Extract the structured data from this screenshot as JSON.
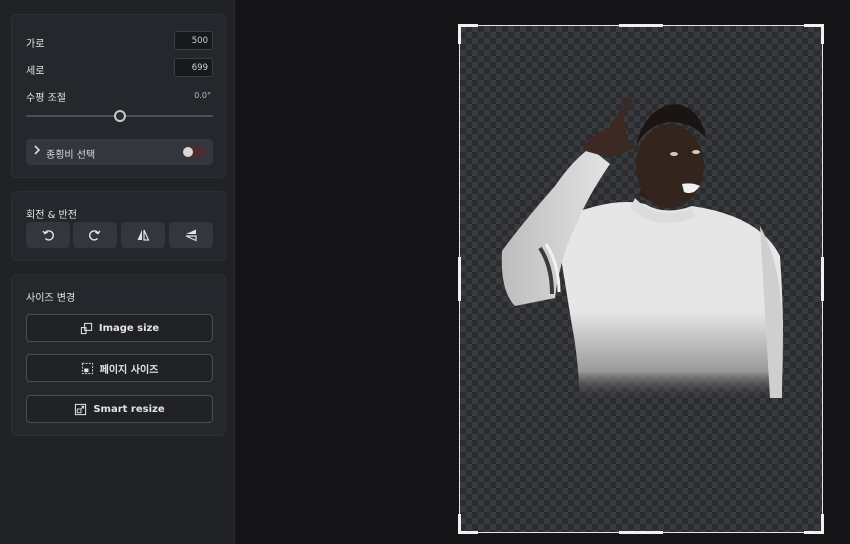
{
  "sidebar": {
    "dimensions": {
      "width_label": "가로",
      "width_value": "500",
      "height_label": "세로",
      "height_value": "699",
      "straighten_label": "수평 조절",
      "straighten_value": "0.0°",
      "aspect_label": "종횡비 선택",
      "aspect_lock_on": false
    },
    "rotate_flip": {
      "title": "회전 & 반전",
      "buttons": [
        "rotate-left-icon",
        "rotate-right-icon",
        "flip-horizontal-icon",
        "flip-vertical-icon"
      ]
    },
    "resize": {
      "title": "사이즈 변경",
      "image_size_label": "Image size",
      "page_size_label": "페이지 사이즈",
      "smart_resize_label": "Smart resize"
    }
  },
  "colors": {
    "sidebar_bg": "#202226",
    "panel_bg": "#24272c",
    "canvas_bg": "#151517",
    "toggle_off": "#4a2e31"
  }
}
